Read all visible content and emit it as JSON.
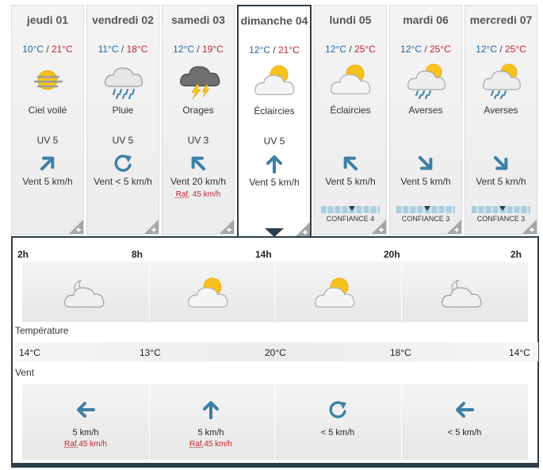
{
  "days": [
    {
      "name": "jeudi 01",
      "tmin": "10°C",
      "sep": " / ",
      "tmax": "21°C",
      "icon": "veiled-sun-icon",
      "condition": "Ciel voilé",
      "uv": "UV 5",
      "wind_dir": "NE",
      "wind": "Vent 5 km/h",
      "gust": "",
      "confidence": "",
      "active": false
    },
    {
      "name": "vendredi 02",
      "tmin": "11°C",
      "sep": " / ",
      "tmax": "18°C",
      "icon": "rain-cloud-icon",
      "condition": "Pluie",
      "uv": "UV 5",
      "wind_dir": "variable",
      "wind": "Vent < 5 km/h",
      "gust": "",
      "confidence": "",
      "active": false
    },
    {
      "name": "samedi 03",
      "tmin": "12°C",
      "sep": " / ",
      "tmax": "19°C",
      "icon": "thunderstorm-icon",
      "condition": "Orages",
      "uv": "UV 3",
      "wind_dir": "NW",
      "wind": "Vent 20 km/h",
      "gust_prefix": "Raf.",
      "gust_value": " 45 km/h",
      "confidence": "",
      "active": false
    },
    {
      "name": "dimanche 04",
      "tmin": "12°C",
      "sep": " / ",
      "tmax": "21°C",
      "icon": "partly-cloudy-icon",
      "condition": "Éclaircies",
      "uv": "UV 5",
      "wind_dir": "N",
      "wind": "Vent 5 km/h",
      "gust": "",
      "confidence": "",
      "active": true
    },
    {
      "name": "lundi 05",
      "tmin": "12°C",
      "sep": " / ",
      "tmax": "25°C",
      "icon": "partly-cloudy-icon",
      "condition": "Éclaircies",
      "uv": "",
      "wind_dir": "NW",
      "wind": "Vent 5 km/h",
      "gust": "",
      "confidence": "CONFIANCE 4",
      "active": false
    },
    {
      "name": "mardi 06",
      "tmin": "12°C",
      "sep": " / ",
      "tmax": "25°C",
      "icon": "sun-showers-icon",
      "condition": "Averses",
      "uv": "",
      "wind_dir": "SE",
      "wind": "Vent 5 km/h",
      "gust": "",
      "confidence": "CONFIANCE 3",
      "active": false
    },
    {
      "name": "mercredi 07",
      "tmin": "12°C",
      "sep": " / ",
      "tmax": "25°C",
      "icon": "sun-showers-icon",
      "condition": "Averses",
      "uv": "",
      "wind_dir": "SE",
      "wind": "Vent 5 km/h",
      "gust": "",
      "confidence": "CONFIANCE 3",
      "active": false
    }
  ],
  "detail": {
    "hours": [
      "2h",
      "8h",
      "14h",
      "20h",
      "2h"
    ],
    "period_icons": [
      "night-cloud-icon",
      "partly-cloudy-icon",
      "partly-cloudy-icon",
      "night-cloud-icon"
    ],
    "temperature_label": "Température",
    "temperatures": [
      "14°C",
      "13°C",
      "20°C",
      "18°C",
      "14°C"
    ],
    "wind_label": "Vent",
    "winds": [
      {
        "dir": "W",
        "speed": "5 km/h",
        "gust_prefix": "Raf.",
        "gust_value": "45 km/h"
      },
      {
        "dir": "N",
        "speed": "5 km/h",
        "gust_prefix": "Raf.",
        "gust_value": "45 km/h"
      },
      {
        "dir": "variable",
        "speed": "< 5 km/h",
        "gust_prefix": "",
        "gust_value": ""
      },
      {
        "dir": "W",
        "speed": "< 5 km/h",
        "gust_prefix": "",
        "gust_value": ""
      }
    ]
  },
  "colors": {
    "tmin": "#2268a6",
    "tmax": "#c2262e",
    "arrow": "#3d7fa6",
    "frame": "#2c3d4a"
  }
}
